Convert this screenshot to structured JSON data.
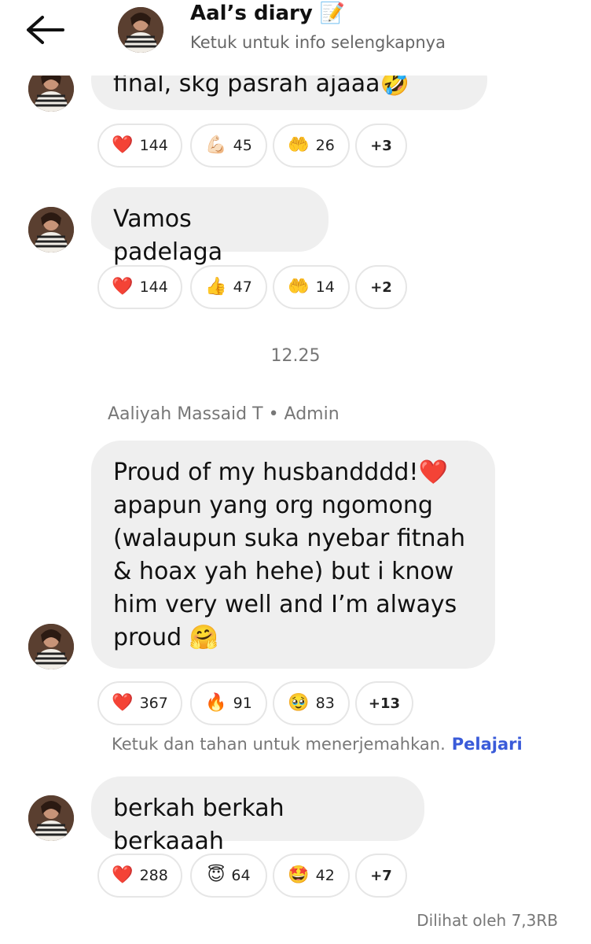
{
  "header": {
    "title": "Aal’s diary",
    "title_emoji": "📝",
    "subtitle": "Ketuk untuk info selengkapnya",
    "back_icon": "arrow-left-icon"
  },
  "messages": [
    {
      "text": "final, skg pasrah ajaaa🤣",
      "reactions": [
        {
          "emoji": "❤️",
          "count": "144"
        },
        {
          "emoji": "💪🏻",
          "count": "45"
        },
        {
          "emoji": "🤲",
          "count": "26"
        }
      ],
      "more": "+3"
    },
    {
      "text": "Vamos padelaga",
      "reactions": [
        {
          "emoji": "❤️",
          "count": "144"
        },
        {
          "emoji": "👍",
          "count": "47"
        },
        {
          "emoji": "🤲",
          "count": "14"
        }
      ],
      "more": "+2"
    },
    {
      "sender": "Aaliyah Massaid T • Admin",
      "lines": [
        "Proud of my husbandddd!❤️",
        "apapun yang org ngomong",
        "(walaupun suka nyebar fitnah",
        "& hoax yah hehe) but i know",
        "him very well and I’m always",
        "proud 🤗"
      ],
      "reactions": [
        {
          "emoji": "❤️",
          "count": "367"
        },
        {
          "emoji": "🔥",
          "count": "91"
        },
        {
          "emoji": "🥹",
          "count": "83"
        }
      ],
      "more": "+13"
    },
    {
      "text": "berkah berkah berkaaah",
      "reactions": [
        {
          "emoji": "❤️",
          "count": "288"
        },
        {
          "emoji": "😇",
          "count": "64"
        },
        {
          "emoji": "🤩",
          "count": "42"
        }
      ],
      "more": "+7"
    }
  ],
  "timestamp": "12.25",
  "translate_hint": "Ketuk dan tahan untuk menerjemahkan.",
  "translate_link": "Pelajari",
  "seen_by": "Dilihat oleh 7,3RB",
  "colors": {
    "link": "#3a5bd9",
    "bubble": "#efefef",
    "muted": "#777777"
  }
}
